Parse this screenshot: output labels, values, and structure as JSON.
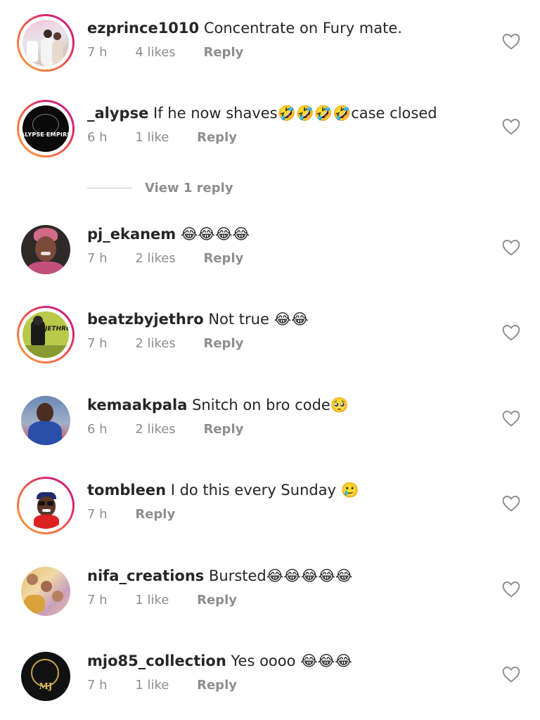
{
  "comments": [
    {
      "username": "ezprince1010",
      "text": "Concentrate on Fury mate.",
      "time": "7 h",
      "likes": "4 likes",
      "reply": "Reply",
      "story": true,
      "avatar_icon": "couple-photo"
    },
    {
      "username": "_alypse",
      "text": "If he now shaves🤣🤣🤣🤣case closed",
      "time": "6 h",
      "likes": "1 like",
      "reply": "Reply",
      "story": true,
      "avatar_icon": "alypse-empire-logo",
      "avatar_text": "ALYPSE EMPIRE"
    },
    {
      "username": "pj_ekanem",
      "text": "😂😂😂😂",
      "time": "7 h",
      "likes": "2 likes",
      "reply": "Reply",
      "story": false,
      "avatar_icon": "woman-portrait"
    },
    {
      "username": "beatzbyjethro",
      "text": "Not true 😂😂",
      "time": "7 h",
      "likes": "2 likes",
      "reply": "Reply",
      "story": true,
      "avatar_icon": "beatzbyjethro-logo",
      "avatar_text": "JETHRO"
    },
    {
      "username": "kemaakpala",
      "text": "Snitch on bro code🥺",
      "time": "6 h",
      "likes": "2 likes",
      "reply": "Reply",
      "story": false,
      "avatar_icon": "man-portrait"
    },
    {
      "username": "tombleen",
      "text": "I do this every Sunday 🥲",
      "time": "7 h",
      "likes": "",
      "reply": "Reply",
      "story": true,
      "avatar_icon": "cartoon-avatar"
    },
    {
      "username": "nifa_creations",
      "text": "Bursted😂😂😂😂😂",
      "time": "7 h",
      "likes": "1 like",
      "reply": "Reply",
      "story": false,
      "avatar_icon": "fashion-collage"
    },
    {
      "username": "mjo85_collection",
      "text": "Yes oooo 😂😂😂",
      "time": "7 h",
      "likes": "1 like",
      "reply": "Reply",
      "story": false,
      "avatar_icon": "mj-fashion-logo",
      "avatar_text": "MJ"
    }
  ],
  "view_reply": {
    "label": "View 1 reply"
  },
  "colors": {
    "primary_text": "#262626",
    "secondary_text": "#8e8e8e",
    "story_ring_start": "#f9a13c",
    "story_ring_end": "#b9248f"
  }
}
